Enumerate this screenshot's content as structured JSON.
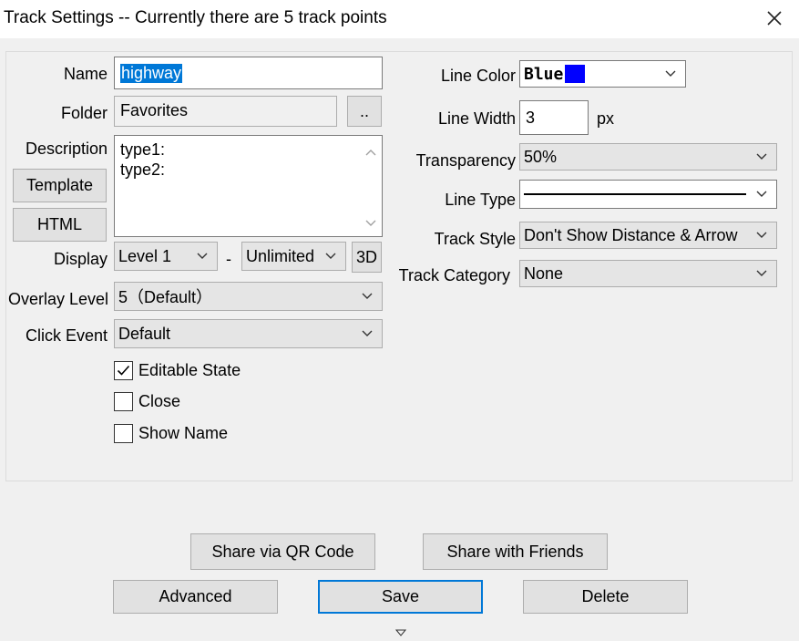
{
  "window": {
    "title": "Track Settings -- Currently there are 5 track points"
  },
  "form": {
    "name_label": "Name",
    "name_value": "highway",
    "folder_label": "Folder",
    "folder_value": "Favorites",
    "folder_browse_label": "..",
    "description_label": "Description",
    "description_lines": [
      "type1:",
      "type2:"
    ],
    "template_button": "Template",
    "html_button": "HTML",
    "display_label": "Display",
    "display_min": "Level 1",
    "display_separator": "-",
    "display_max": "Unlimited",
    "display_3d_button": "3D",
    "overlay_label": "Overlay Level",
    "overlay_value": "5（Default）",
    "click_event_label": "Click Event",
    "click_event_value": "Default",
    "checkboxes": [
      {
        "label": "Editable State",
        "checked": true
      },
      {
        "label": "Close",
        "checked": false
      },
      {
        "label": "Show Name",
        "checked": false
      }
    ],
    "line_color_label": "Line Color",
    "line_color_value": "Blue",
    "line_color_swatch": "#0000ff",
    "line_width_label": "Line Width",
    "line_width_value": "3",
    "line_width_unit": "px",
    "transparency_label": "Transparency",
    "transparency_value": "50%",
    "line_type_label": "Line Type",
    "track_style_label": "Track Style",
    "track_style_value": "Don't Show Distance & Arrow",
    "track_category_label": "Track Category",
    "track_category_value": "None"
  },
  "actions": {
    "share_qr": "Share via QR Code",
    "share_friends": "Share with Friends",
    "advanced": "Advanced",
    "save": "Save",
    "delete": "Delete"
  },
  "colors": {
    "selection": "#0078d7",
    "default_button_border": "#0078d7"
  }
}
